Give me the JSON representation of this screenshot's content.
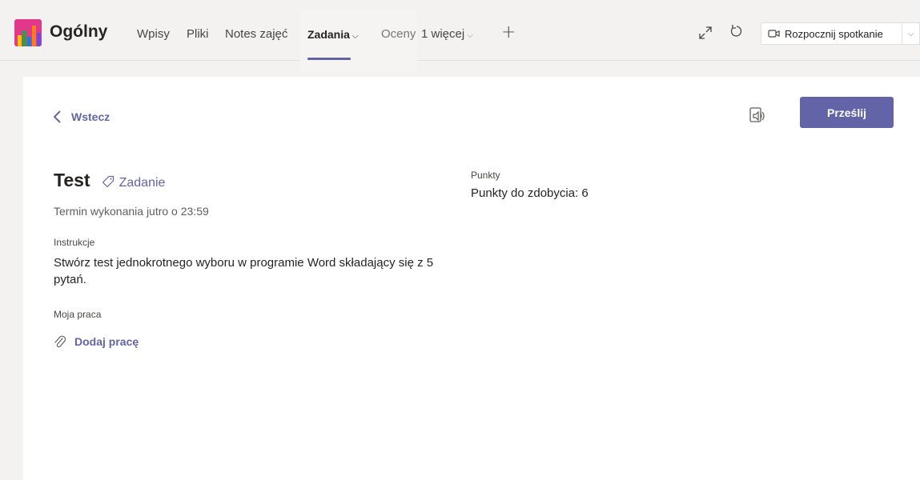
{
  "header": {
    "channel_name": "Ogólny",
    "tabs": [
      {
        "label": "Wpisy"
      },
      {
        "label": "Pliki"
      },
      {
        "label": "Notes zajęć"
      },
      {
        "label": "Zadania"
      },
      {
        "label": "Oceny"
      },
      {
        "label": "1 więcej"
      }
    ],
    "meeting_button_label": "Rozpocznij spotkanie"
  },
  "panel": {
    "back_label": "Wstecz",
    "submit_label": "Prześlij",
    "assignment": {
      "title": "Test",
      "type_label": "Zadanie",
      "due": "Termin wykonania jutro o 23:59",
      "instructions_label": "Instrukcje",
      "instructions_text": "Stwórz test jednokrotnego wyboru w programie Word składający się z 5 pytań.",
      "my_work_label": "Moja praca",
      "add_work_label": "Dodaj pracę"
    },
    "points": {
      "label": "Punkty",
      "value": "Punkty do zdobycia: 6"
    }
  },
  "colors": {
    "accent": "#6264a7",
    "logo": "#e2388b",
    "background": "#f3f2f1",
    "panel": "#ffffff"
  },
  "icons": [
    "team-logo-pencils",
    "chevron-down-icon",
    "plus-icon",
    "expand-icon",
    "refresh-icon",
    "video-camera-icon",
    "chevron-left-icon",
    "immersive-reader-icon",
    "tag-icon",
    "paperclip-icon"
  ]
}
